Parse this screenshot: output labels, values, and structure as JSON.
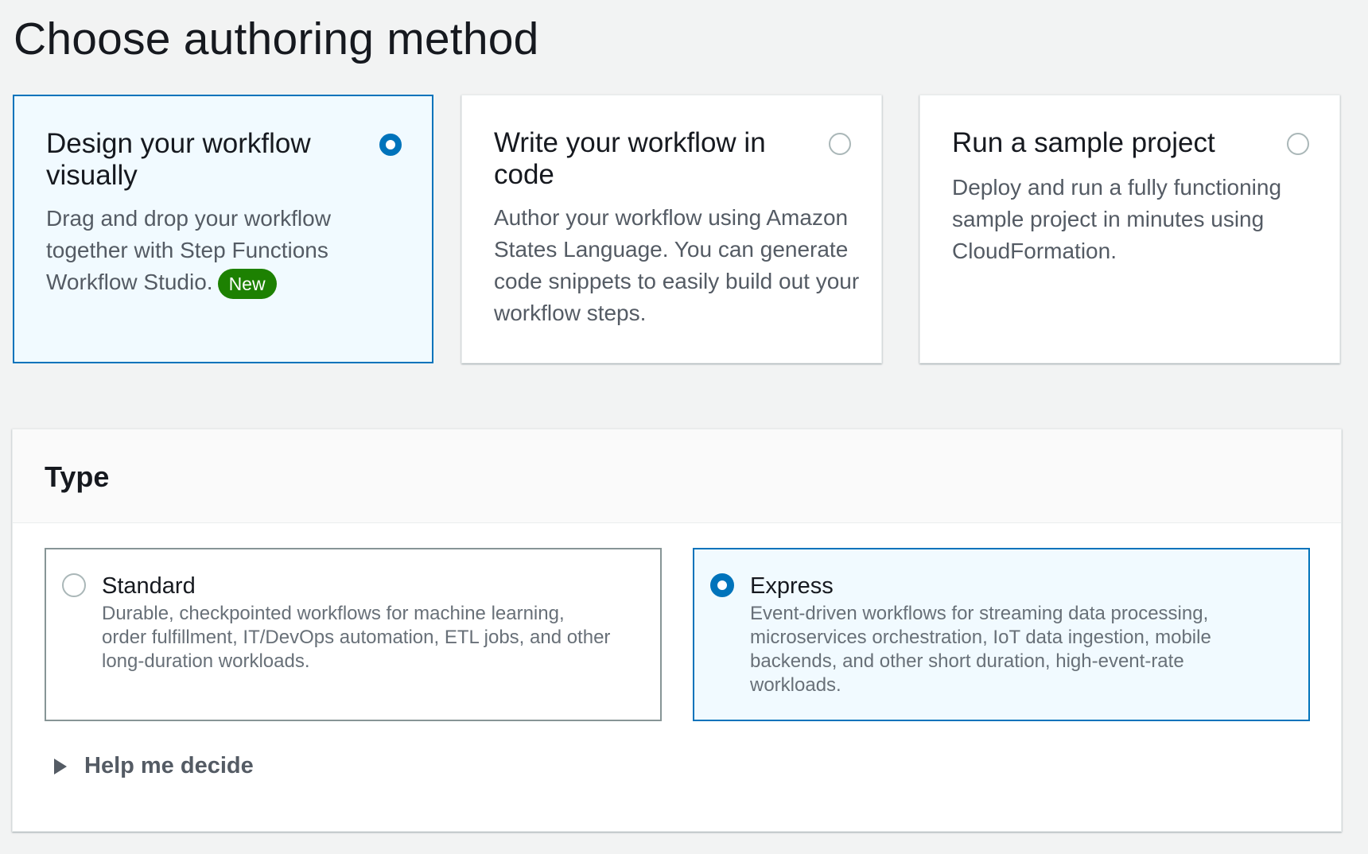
{
  "page": {
    "title": "Choose authoring method"
  },
  "authoring_methods": [
    {
      "title": "Design your workflow visually",
      "description": "Drag and drop your workflow together with Step Functions Workflow Studio.",
      "badge": "New",
      "selected": true
    },
    {
      "title": "Write your workflow in code",
      "description": "Author your workflow using Amazon States Language. You can generate code snippets to easily build out your workflow steps.",
      "selected": false
    },
    {
      "title": "Run a sample project",
      "description": "Deploy and run a fully functioning sample project in minutes using CloudFormation.",
      "selected": false
    }
  ],
  "type_section": {
    "heading": "Type",
    "options": [
      {
        "title": "Standard",
        "description": "Durable, checkpointed workflows for machine learning, order fulfillment, IT/DevOps automation, ETL jobs, and other long-duration workloads.",
        "selected": false
      },
      {
        "title": "Express",
        "description": "Event-driven workflows for streaming data processing, microservices orchestration, IoT data ingestion, mobile backends, and other short duration, high-event-rate workloads.",
        "selected": true
      }
    ],
    "help_label": "Help me decide"
  },
  "colors": {
    "accent": "#0073bb",
    "selected_bg": "#f1faff",
    "badge_green": "#1d8102",
    "page_bg": "#f2f3f3"
  }
}
